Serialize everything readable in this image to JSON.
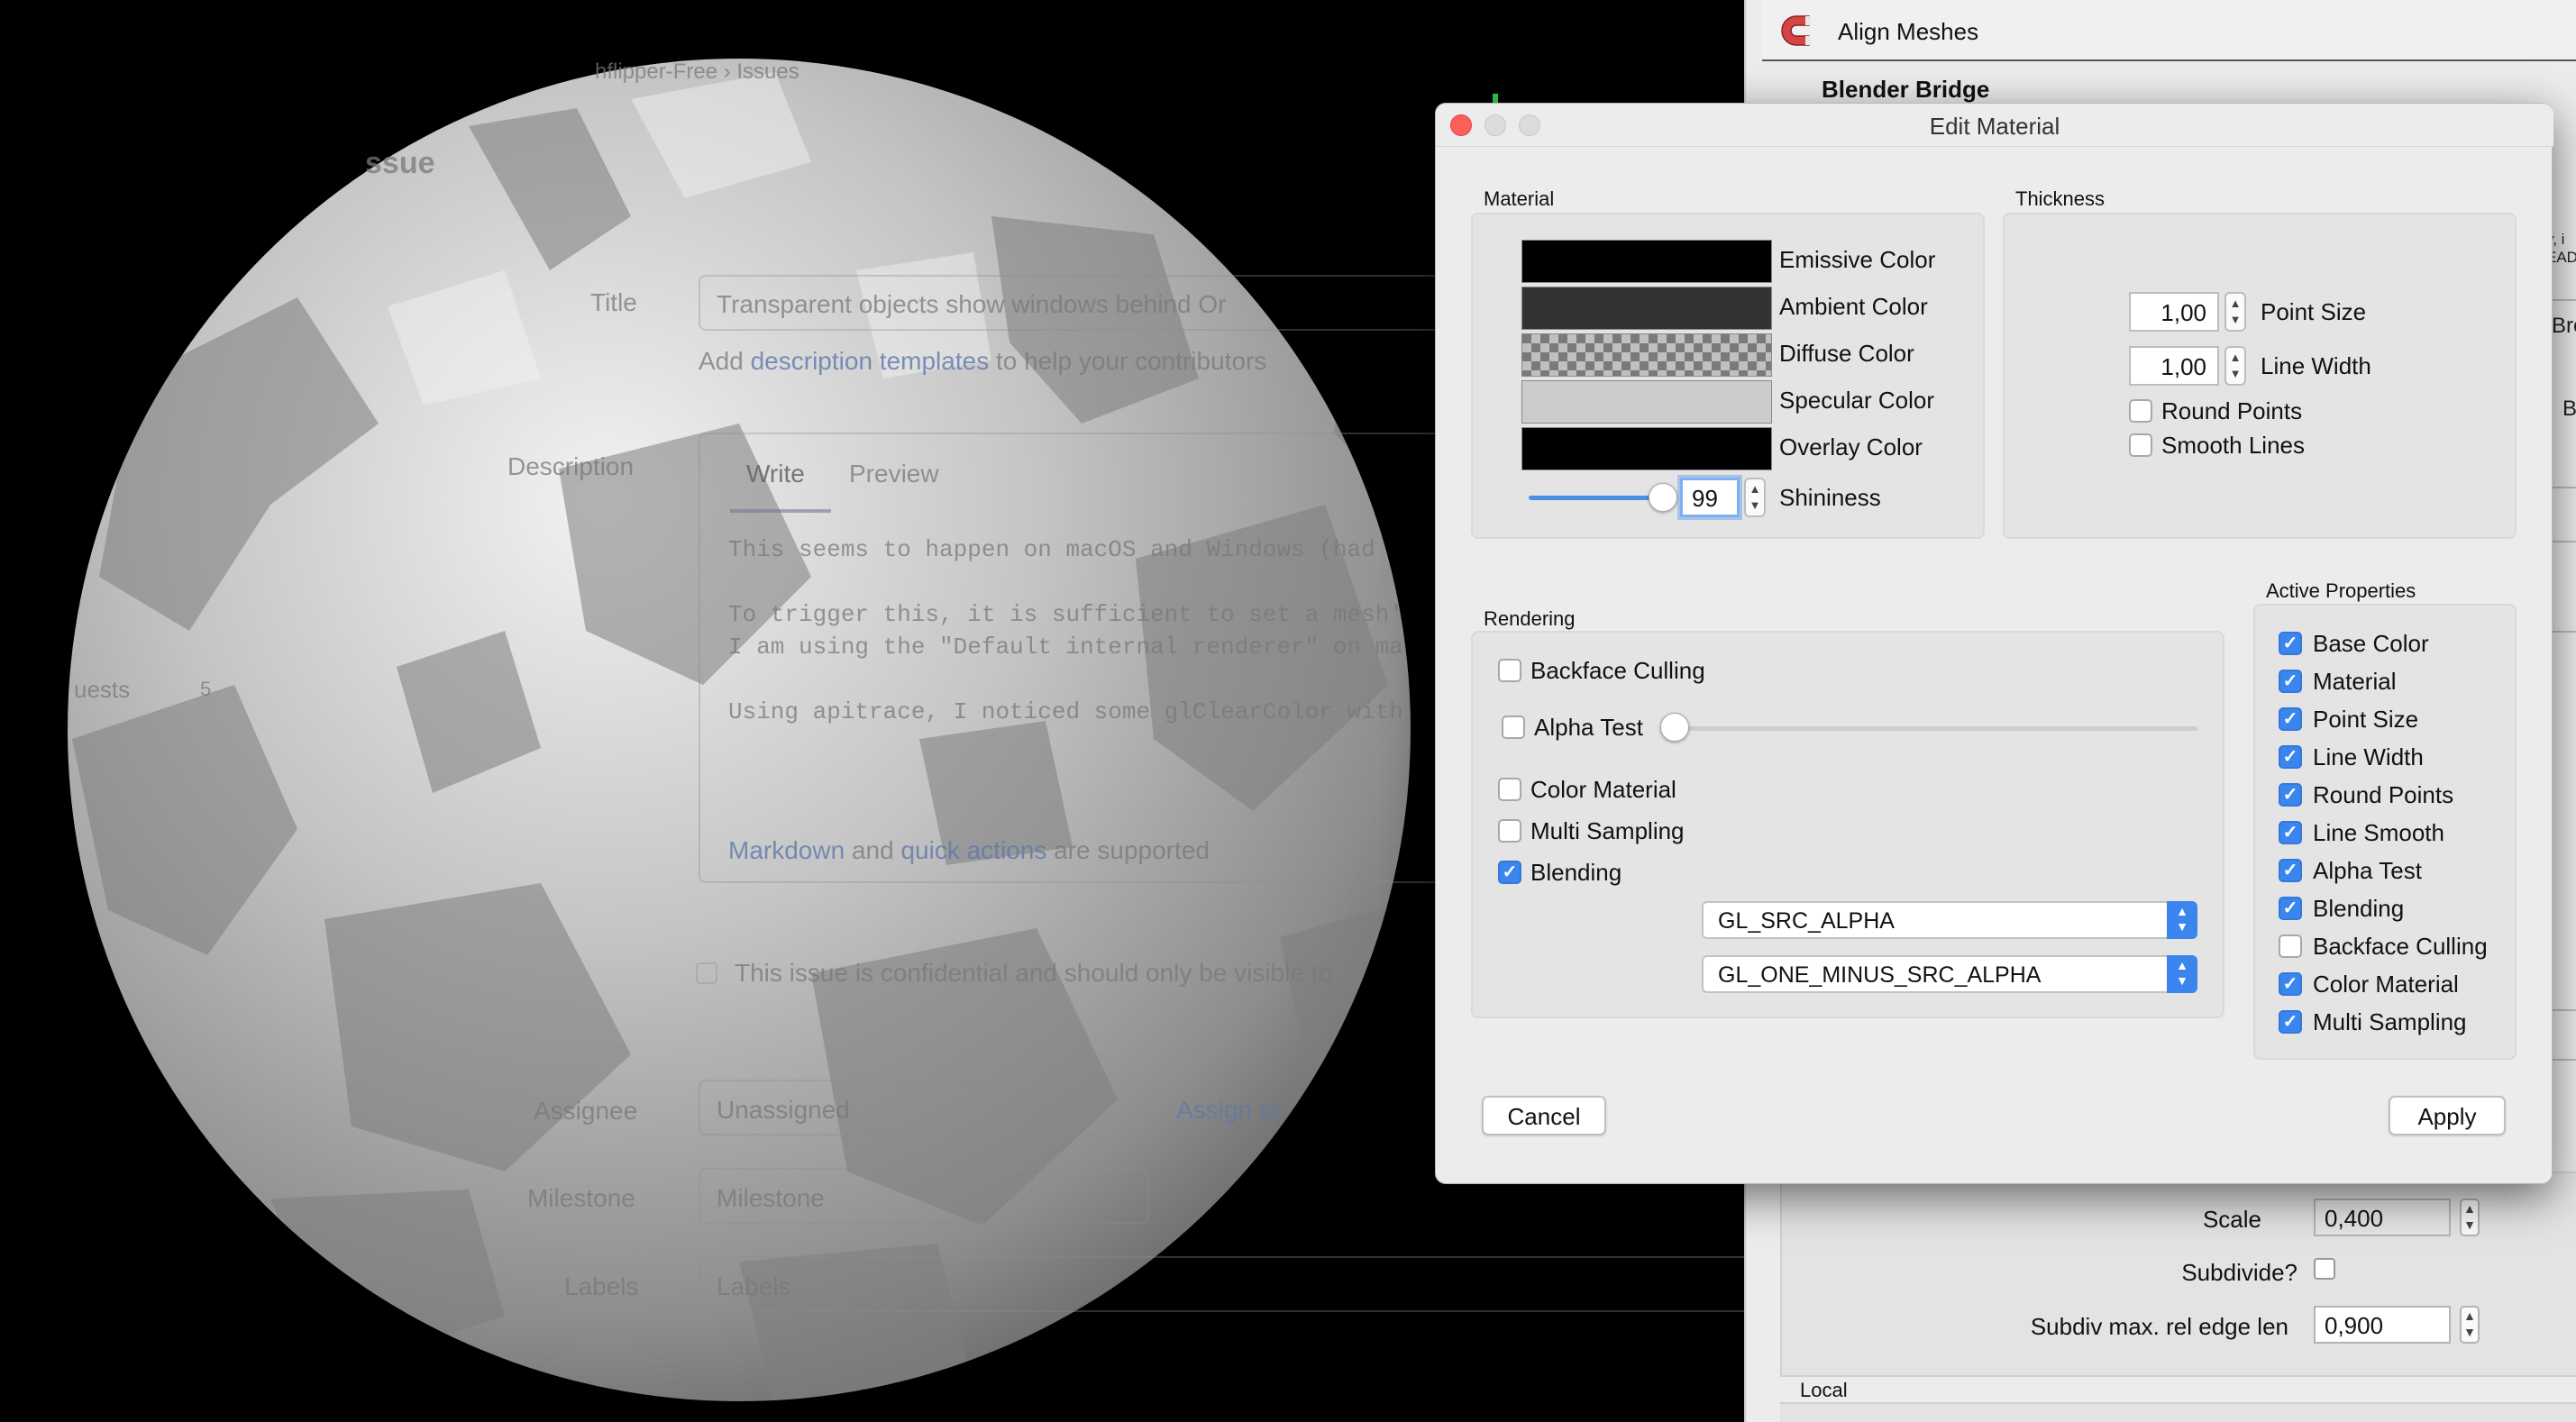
{
  "background_page": {
    "breadcrumb": "hflipper-Free  ›  Issues",
    "new_issue_heading": "ssue",
    "title_label": "Title",
    "title_value": "Transparent objects show windows behind Or",
    "templates_prefix": "Add ",
    "templates_link": "description templates",
    "templates_suffix": " to help your contributors",
    "description_label": "Description",
    "tab_write": "Write",
    "tab_preview": "Preview",
    "desc_line1": "This seems to happen on macOS and Windows (had",
    "desc_line2": "To trigger this, it is sufficient to set a mesh'",
    "desc_line3": "I am using the \"Default internal renderer\" on ma",
    "desc_line4": "Using apitrace, I noticed some glClearColor with",
    "markdown_link": "Markdown",
    "markdown_and": "and",
    "quick_actions_link": "quick actions",
    "supported_text": "are supported",
    "confidential_text": "This issue is confidential and should only be visible to",
    "requests_label": "uests",
    "requests_count": "5",
    "assignee_label": "Assignee",
    "assignee_value": "Unassigned",
    "assign_to_me": "Assign to",
    "milestone_label": "Milestone",
    "milestone_value": "Milestone",
    "labels_label": "Labels",
    "labels_value": "Labels"
  },
  "side_panel": {
    "header_title": "Align Meshes",
    "section_title": "Blender Bridge",
    "scale_label": "Scale",
    "scale_value": "0,400",
    "subdivide_label": "Subdivide?",
    "subdiv_len_label": "Subdiv max. rel edge len",
    "subdiv_len_value": "0,900",
    "local_label": "Local",
    "edge_text_1": "y, i",
    "edge_text_2": "EAD",
    "edge_text_3": "Bro",
    "edge_text_4": "B"
  },
  "dialog": {
    "title": "Edit Material",
    "material": {
      "group_label": "Material",
      "colors": [
        {
          "label": "Emissive Color",
          "color": "#000000"
        },
        {
          "label": "Ambient Color",
          "color": "#333333"
        },
        {
          "label": "Diffuse Color",
          "color": "checker"
        },
        {
          "label": "Specular Color",
          "color": "#cccccc"
        },
        {
          "label": "Overlay Color",
          "color": "#000000"
        }
      ],
      "shininess_label": "Shininess",
      "shininess_value": "99",
      "shininess_fraction": 0.99
    },
    "thickness": {
      "group_label": "Thickness",
      "point_size_label": "Point Size",
      "point_size_value": "1,00",
      "line_width_label": "Line Width",
      "line_width_value": "1,00",
      "round_points_label": "Round Points",
      "round_points_checked": false,
      "smooth_lines_label": "Smooth Lines",
      "smooth_lines_checked": false
    },
    "rendering": {
      "group_label": "Rendering",
      "backface_culling_label": "Backface Culling",
      "backface_culling_checked": false,
      "alpha_test_label": "Alpha Test",
      "alpha_test_checked": false,
      "alpha_test_fraction": 0.0,
      "color_material_label": "Color Material",
      "color_material_checked": false,
      "multi_sampling_label": "Multi Sampling",
      "multi_sampling_checked": false,
      "blending_label": "Blending",
      "blending_checked": true,
      "src_blend": "GL_SRC_ALPHA",
      "dst_blend": "GL_ONE_MINUS_SRC_ALPHA"
    },
    "active_properties": {
      "group_label": "Active Properties",
      "items": [
        {
          "label": "Base Color",
          "checked": true
        },
        {
          "label": "Material",
          "checked": true
        },
        {
          "label": "Point Size",
          "checked": true
        },
        {
          "label": "Line Width",
          "checked": true
        },
        {
          "label": "Round Points",
          "checked": true
        },
        {
          "label": "Line Smooth",
          "checked": true
        },
        {
          "label": "Alpha Test",
          "checked": true
        },
        {
          "label": "Blending",
          "checked": true
        },
        {
          "label": "Backface Culling",
          "checked": false
        },
        {
          "label": "Color Material",
          "checked": true
        },
        {
          "label": "Multi Sampling",
          "checked": true
        }
      ]
    },
    "cancel_label": "Cancel",
    "apply_label": "Apply"
  },
  "colors": {
    "accent": "#3b86ee",
    "close_button": "#fc5f57",
    "dialog_bg": "#ececec"
  }
}
